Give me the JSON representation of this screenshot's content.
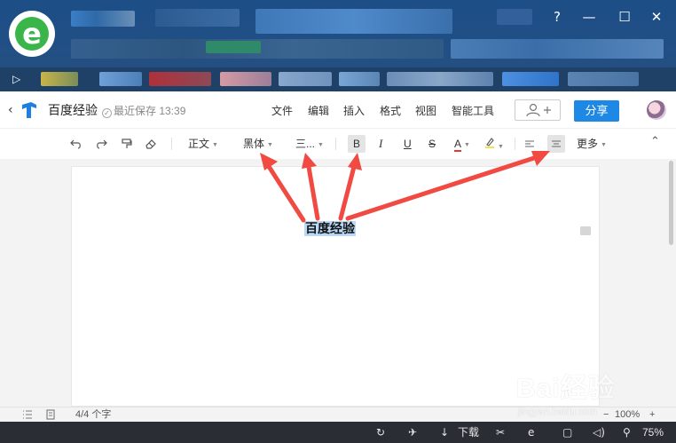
{
  "browser": {
    "window_controls": [
      "?",
      "—",
      "☐",
      "✕"
    ]
  },
  "header": {
    "back_icon": "chevron-left-icon",
    "doc_title": "百度经验",
    "save_status": "最近保存 13:39",
    "menu": [
      "文件",
      "编辑",
      "插入",
      "格式",
      "视图",
      "智能工具"
    ],
    "collab_icon": "add-collaborator-icon",
    "share_label": "分享"
  },
  "toolbar": {
    "undo_icon": "undo-icon",
    "redo_icon": "redo-icon",
    "format_painter_icon": "format-painter-icon",
    "eraser_icon": "clear-format-icon",
    "paragraph_style": "正文",
    "font_family": "黑体",
    "font_size": "三...",
    "bold": "B",
    "italic": "I",
    "underline": "U",
    "strike": "S",
    "font_color": "A",
    "highlight_icon": "highlighter-icon",
    "align_left_icon": "align-left-icon",
    "align_center_icon": "align-center-icon",
    "more": "更多",
    "collapse_icon": "chevron-up-icon"
  },
  "document": {
    "selected_text": "百度经验"
  },
  "status_bar": {
    "word_count": "4/4 个字",
    "zoom_minus": "−",
    "zoom": "100%",
    "zoom_plus": "+"
  },
  "taskbar": {
    "download_label": "下载",
    "zoom_level": "75%"
  },
  "watermark": {
    "brand": "Bai経验",
    "url": "jingyan.baidu.com"
  },
  "colors": {
    "accent": "#1e88e5",
    "arrow": "#f04a42",
    "selection": "#b9d9f7"
  }
}
